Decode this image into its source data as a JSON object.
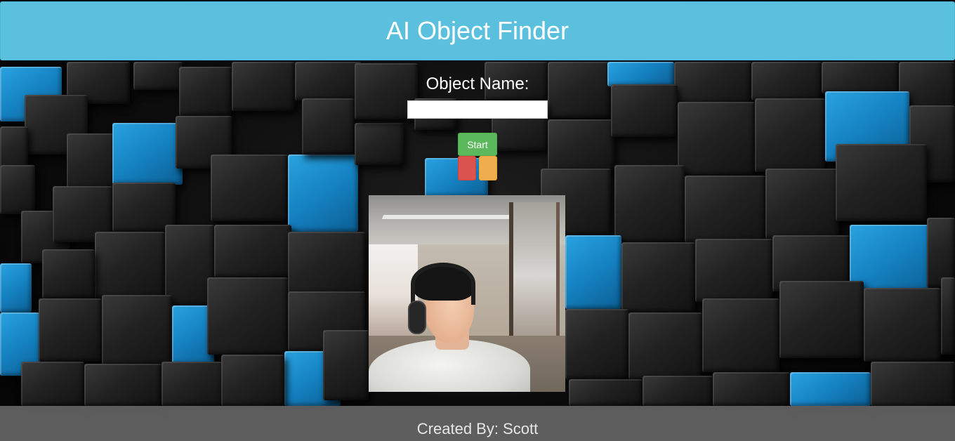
{
  "header": {
    "title": "AI Object Finder"
  },
  "form": {
    "label": "Object Name:",
    "input_value": "",
    "start_label": "Start"
  },
  "footer": {
    "text": "Created By: Scott"
  },
  "colors": {
    "header_bg": "#5bc0de",
    "start_button": "#5cb85c",
    "red_button": "#d9534f",
    "orange_button": "#f0ad4e",
    "footer_bg": "#808080"
  }
}
